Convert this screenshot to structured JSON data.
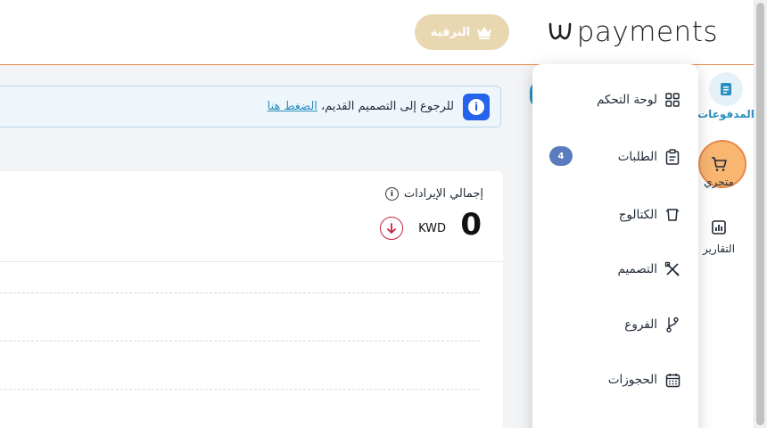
{
  "header": {
    "logo_text": "payments",
    "upgrade_label": "الترقية"
  },
  "banner": {
    "text": "للرجوع إلى التصميم القديم،",
    "link": "الضغط هنا"
  },
  "revenue": {
    "title": "إجمالي الإيرادات",
    "value": "0",
    "currency": "KWD"
  },
  "sidebar": {
    "items": [
      {
        "label": "المدفوعات",
        "icon": "payments-doc-icon"
      },
      {
        "label": "متجري",
        "icon": "cart-icon"
      },
      {
        "label": "التقارير",
        "icon": "bar-chart-icon"
      }
    ]
  },
  "menu": {
    "items": [
      {
        "label": "لوحة التحكم",
        "icon": "grid-icon"
      },
      {
        "label": "الطلبات",
        "icon": "clipboard-icon",
        "badge": "4"
      },
      {
        "label": "الكتالوج",
        "icon": "catalog-icon"
      },
      {
        "label": "التصميم",
        "icon": "design-tools-icon"
      },
      {
        "label": "الفروع",
        "icon": "branch-icon"
      },
      {
        "label": "الحجوزات",
        "icon": "calendar-icon"
      }
    ]
  },
  "colors": {
    "accent_orange": "#e8894a",
    "brand_blue": "#2a8fbd",
    "upgrade_bg": "#e9d7b1",
    "badge_bg": "#5b7bbf",
    "trend_red": "#c0263f"
  }
}
